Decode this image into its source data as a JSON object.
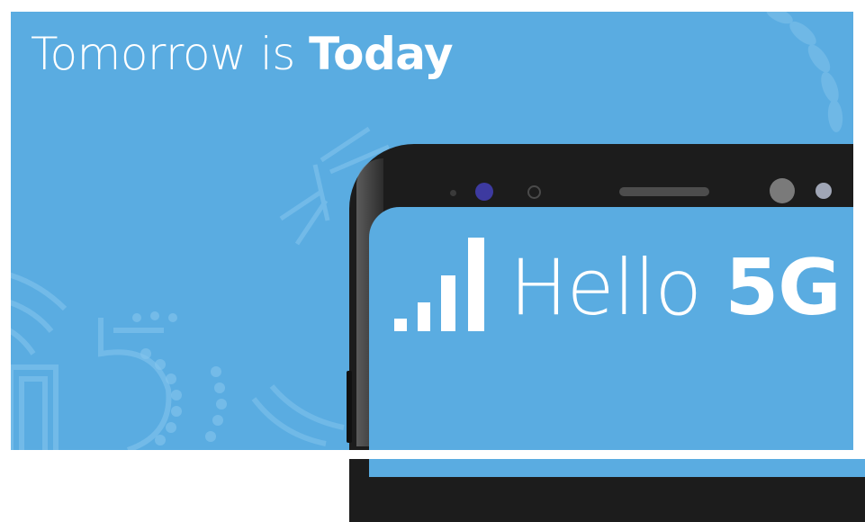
{
  "banner": {
    "headline_light": "Tomorrow is ",
    "headline_bold": "Today",
    "greeting_light": "Hello ",
    "greeting_bold": "5G"
  },
  "signal_bars": 4,
  "colors": {
    "background": "#5aace1",
    "text": "#ffffff",
    "phone_bezel": "#1c1c1c",
    "camera": "#3d3aa0"
  },
  "icons": [
    "signal-strength-icon",
    "front-camera-icon",
    "earpiece-speaker-icon",
    "proximity-sensor-icon"
  ]
}
